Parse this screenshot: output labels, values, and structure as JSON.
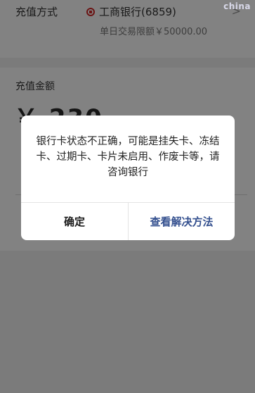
{
  "method": {
    "label": "充值方式",
    "bank_name": "工商银行(6859)",
    "limit": "单日交易限额￥50000.00",
    "chevron": ">",
    "bank_icon": "icbc-logo-icon"
  },
  "watermark": "china",
  "amount": {
    "label": "充值金额",
    "value": "￥ 230"
  },
  "dialog": {
    "message": "银行卡状态不正确，可能是挂失卡、冻结卡、过期卡、卡片未启用、作废卡等，请咨询银行",
    "confirm_label": "确定",
    "solution_label": "查看解决方法"
  },
  "colors": {
    "overlay": "#7b7b7b",
    "link_blue": "#34508f"
  }
}
